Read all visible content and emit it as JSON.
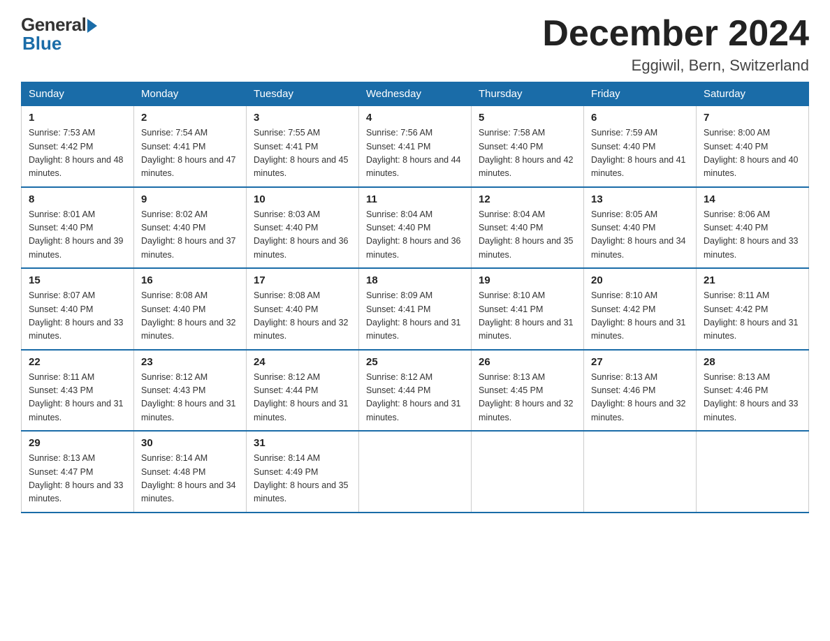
{
  "logo": {
    "general": "General",
    "blue": "Blue"
  },
  "header": {
    "month": "December 2024",
    "location": "Eggiwil, Bern, Switzerland"
  },
  "days_of_week": [
    "Sunday",
    "Monday",
    "Tuesday",
    "Wednesday",
    "Thursday",
    "Friday",
    "Saturday"
  ],
  "weeks": [
    [
      {
        "day": "1",
        "sunrise": "7:53 AM",
        "sunset": "4:42 PM",
        "daylight": "8 hours and 48 minutes."
      },
      {
        "day": "2",
        "sunrise": "7:54 AM",
        "sunset": "4:41 PM",
        "daylight": "8 hours and 47 minutes."
      },
      {
        "day": "3",
        "sunrise": "7:55 AM",
        "sunset": "4:41 PM",
        "daylight": "8 hours and 45 minutes."
      },
      {
        "day": "4",
        "sunrise": "7:56 AM",
        "sunset": "4:41 PM",
        "daylight": "8 hours and 44 minutes."
      },
      {
        "day": "5",
        "sunrise": "7:58 AM",
        "sunset": "4:40 PM",
        "daylight": "8 hours and 42 minutes."
      },
      {
        "day": "6",
        "sunrise": "7:59 AM",
        "sunset": "4:40 PM",
        "daylight": "8 hours and 41 minutes."
      },
      {
        "day": "7",
        "sunrise": "8:00 AM",
        "sunset": "4:40 PM",
        "daylight": "8 hours and 40 minutes."
      }
    ],
    [
      {
        "day": "8",
        "sunrise": "8:01 AM",
        "sunset": "4:40 PM",
        "daylight": "8 hours and 39 minutes."
      },
      {
        "day": "9",
        "sunrise": "8:02 AM",
        "sunset": "4:40 PM",
        "daylight": "8 hours and 37 minutes."
      },
      {
        "day": "10",
        "sunrise": "8:03 AM",
        "sunset": "4:40 PM",
        "daylight": "8 hours and 36 minutes."
      },
      {
        "day": "11",
        "sunrise": "8:04 AM",
        "sunset": "4:40 PM",
        "daylight": "8 hours and 36 minutes."
      },
      {
        "day": "12",
        "sunrise": "8:04 AM",
        "sunset": "4:40 PM",
        "daylight": "8 hours and 35 minutes."
      },
      {
        "day": "13",
        "sunrise": "8:05 AM",
        "sunset": "4:40 PM",
        "daylight": "8 hours and 34 minutes."
      },
      {
        "day": "14",
        "sunrise": "8:06 AM",
        "sunset": "4:40 PM",
        "daylight": "8 hours and 33 minutes."
      }
    ],
    [
      {
        "day": "15",
        "sunrise": "8:07 AM",
        "sunset": "4:40 PM",
        "daylight": "8 hours and 33 minutes."
      },
      {
        "day": "16",
        "sunrise": "8:08 AM",
        "sunset": "4:40 PM",
        "daylight": "8 hours and 32 minutes."
      },
      {
        "day": "17",
        "sunrise": "8:08 AM",
        "sunset": "4:40 PM",
        "daylight": "8 hours and 32 minutes."
      },
      {
        "day": "18",
        "sunrise": "8:09 AM",
        "sunset": "4:41 PM",
        "daylight": "8 hours and 31 minutes."
      },
      {
        "day": "19",
        "sunrise": "8:10 AM",
        "sunset": "4:41 PM",
        "daylight": "8 hours and 31 minutes."
      },
      {
        "day": "20",
        "sunrise": "8:10 AM",
        "sunset": "4:42 PM",
        "daylight": "8 hours and 31 minutes."
      },
      {
        "day": "21",
        "sunrise": "8:11 AM",
        "sunset": "4:42 PM",
        "daylight": "8 hours and 31 minutes."
      }
    ],
    [
      {
        "day": "22",
        "sunrise": "8:11 AM",
        "sunset": "4:43 PM",
        "daylight": "8 hours and 31 minutes."
      },
      {
        "day": "23",
        "sunrise": "8:12 AM",
        "sunset": "4:43 PM",
        "daylight": "8 hours and 31 minutes."
      },
      {
        "day": "24",
        "sunrise": "8:12 AM",
        "sunset": "4:44 PM",
        "daylight": "8 hours and 31 minutes."
      },
      {
        "day": "25",
        "sunrise": "8:12 AM",
        "sunset": "4:44 PM",
        "daylight": "8 hours and 31 minutes."
      },
      {
        "day": "26",
        "sunrise": "8:13 AM",
        "sunset": "4:45 PM",
        "daylight": "8 hours and 32 minutes."
      },
      {
        "day": "27",
        "sunrise": "8:13 AM",
        "sunset": "4:46 PM",
        "daylight": "8 hours and 32 minutes."
      },
      {
        "day": "28",
        "sunrise": "8:13 AM",
        "sunset": "4:46 PM",
        "daylight": "8 hours and 33 minutes."
      }
    ],
    [
      {
        "day": "29",
        "sunrise": "8:13 AM",
        "sunset": "4:47 PM",
        "daylight": "8 hours and 33 minutes."
      },
      {
        "day": "30",
        "sunrise": "8:14 AM",
        "sunset": "4:48 PM",
        "daylight": "8 hours and 34 minutes."
      },
      {
        "day": "31",
        "sunrise": "8:14 AM",
        "sunset": "4:49 PM",
        "daylight": "8 hours and 35 minutes."
      },
      null,
      null,
      null,
      null
    ]
  ]
}
